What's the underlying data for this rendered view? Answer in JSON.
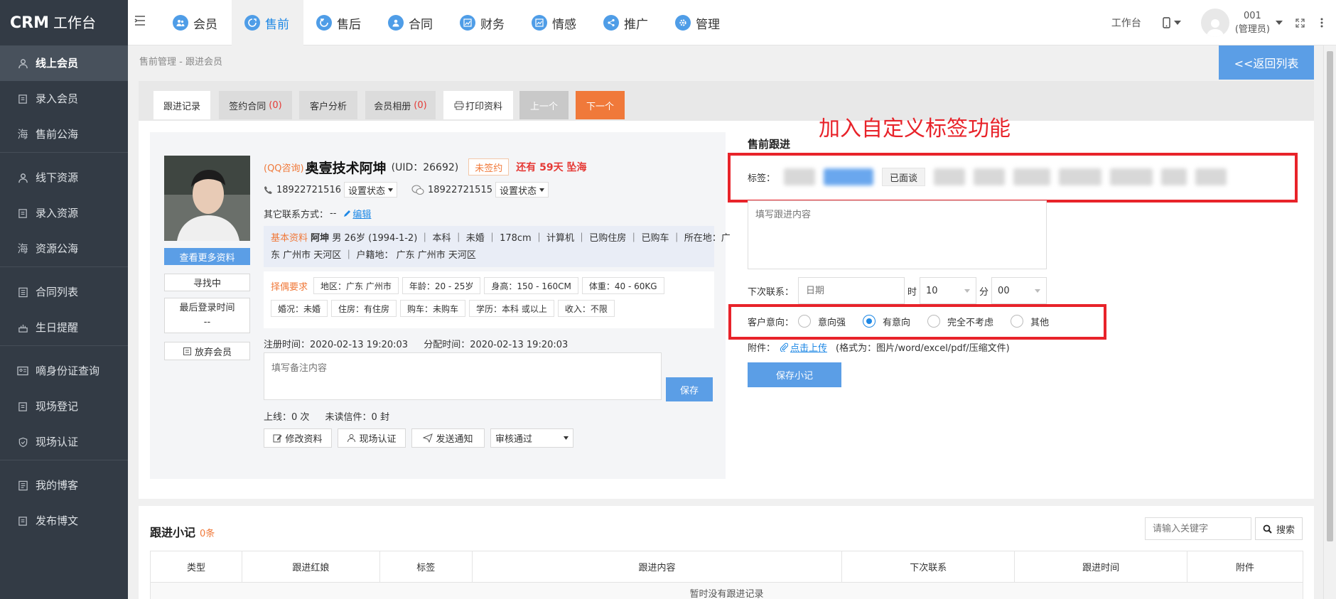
{
  "app": {
    "title_main": "CRM",
    "title_sub": "工作台"
  },
  "sidebar": {
    "groups": [
      [
        {
          "label": "线上会员",
          "icon": "user-icon",
          "active": true
        },
        {
          "label": "录入会员",
          "icon": "edit-icon"
        },
        {
          "label": "售前公海",
          "icon": "sea-icon"
        }
      ],
      [
        {
          "label": "线下资源",
          "icon": "user-icon"
        },
        {
          "label": "录入资源",
          "icon": "edit-icon"
        },
        {
          "label": "资源公海",
          "icon": "sea-icon"
        }
      ],
      [
        {
          "label": "合同列表",
          "icon": "list-icon"
        },
        {
          "label": "生日提醒",
          "icon": "cake-icon"
        }
      ],
      [
        {
          "label": "嘀身份证查询",
          "icon": "id-card-icon"
        },
        {
          "label": "现场登记",
          "icon": "edit-icon"
        },
        {
          "label": "现场认证",
          "icon": "shield-icon"
        }
      ],
      [
        {
          "label": "我的博客",
          "icon": "blog-icon"
        },
        {
          "label": "发布博文",
          "icon": "edit-icon"
        }
      ]
    ],
    "sea_glyph": "海"
  },
  "topnav": {
    "items": [
      {
        "label": "会员",
        "icon": "members-icon"
      },
      {
        "label": "售前",
        "icon": "presale-icon",
        "active": true
      },
      {
        "label": "售后",
        "icon": "aftersale-icon"
      },
      {
        "label": "合同",
        "icon": "contract-icon"
      },
      {
        "label": "财务",
        "icon": "finance-icon"
      },
      {
        "label": "情感",
        "icon": "emotion-icon"
      },
      {
        "label": "推广",
        "icon": "share-icon"
      },
      {
        "label": "管理",
        "icon": "gear-icon"
      }
    ],
    "workbench": "工作台",
    "user_id": "001",
    "user_role": "(管理员)"
  },
  "breadcrumb": "售前管理 - 跟进会员",
  "back_button": "<<返回列表",
  "tabs": [
    {
      "label": "跟进记录",
      "active": true
    },
    {
      "label": "签约合同",
      "count": "(0)"
    },
    {
      "label": "客户分析"
    },
    {
      "label": "会员相册",
      "count": "(0)"
    },
    {
      "label": "打印资料",
      "active": true,
      "icon": "print-icon"
    },
    {
      "label": "上一个",
      "disabled": true
    },
    {
      "label": "下一个",
      "highlight": true
    }
  ],
  "profile": {
    "source": "(QQ咨询)",
    "name": "奥壹技术阿坤",
    "uid": "(UID：26692)",
    "sign_status": "未签约",
    "days_prefix": "还有",
    "days": "59天",
    "days_suffix": "坠海",
    "phone": "18922721516",
    "phone_status": "设置状态",
    "wechat": "18922721515",
    "wechat_status": "设置状态",
    "other_contact_label": "其它联系方式：",
    "other_contact_value": "--",
    "edit_link": "编辑",
    "more_info": "查看更多资料",
    "status": "寻找中",
    "last_login_label": "最后登录时间",
    "last_login_value": "--",
    "abandon": "放弃会员",
    "basic_label": "基本资料",
    "basic_name": "阿坤",
    "basic_line1": "男 26岁 (1994-1-2) ｜ 本科 ｜ 未婚 ｜ 178cm ｜ 计算机 ｜ 已购住房 ｜ 已购车 ｜ 所在地：广",
    "basic_line2": "东 广州市 天河区 ｜ 户籍地： 广东 广州市 天河区",
    "req_label": "择偶要求",
    "requirements_row1": [
      "地区：广东 广州市",
      "年龄：20 - 25岁",
      "身高：150 - 160CM",
      "体重：40 - 60KG"
    ],
    "requirements_row2": [
      "婚况：未婚",
      "住房：有住房",
      "购车：未购车",
      "学历：本科 或以上",
      "收入：不限"
    ],
    "register_time": "注册时间：2020-02-13 19:20:03",
    "assign_time": "分配时间：2020-02-13 19:20:03",
    "note_placeholder": "填写备注内容",
    "save": "保存",
    "online": "上线：0 次",
    "unread": "未读信件：0 封",
    "btn_modify": "修改资料",
    "btn_verify": "现场认证",
    "btn_notify": "发送通知",
    "audit_select": "审核通过"
  },
  "presale": {
    "title": "售前跟进",
    "annotation": "加入自定义标签功能",
    "tag_label": "标签：",
    "visible_tag": "已面谈",
    "content_placeholder": "填写跟进内容",
    "next_contact_label": "下次联系：",
    "date_placeholder": "日期",
    "hour_label": "时",
    "hour_value": "10",
    "minute_label": "分",
    "minute_value": "00",
    "intent_label": "客户意向：",
    "intents": [
      {
        "label": "意向强",
        "checked": false
      },
      {
        "label": "有意向",
        "checked": true
      },
      {
        "label": "完全不考虑",
        "checked": false
      },
      {
        "label": "其他",
        "checked": false
      }
    ],
    "attachment_label": "附件：",
    "upload_link": "点击上传",
    "format_note": "(格式为：图片/word/excel/pdf/压缩文件)",
    "save_note": "保存小记"
  },
  "notes": {
    "title": "跟进小记",
    "count": "0条",
    "search_placeholder": "请输入关键字",
    "search_button": "搜索",
    "columns": [
      "类型",
      "跟进红娘",
      "标签",
      "跟进内容",
      "下次联系",
      "跟进时间",
      "附件"
    ],
    "empty": "暂时没有跟进记录"
  },
  "colors": {
    "accent": "#1e88e5",
    "orange": "#f0793a",
    "red": "#e8232a",
    "sidebar": "#333b45"
  }
}
